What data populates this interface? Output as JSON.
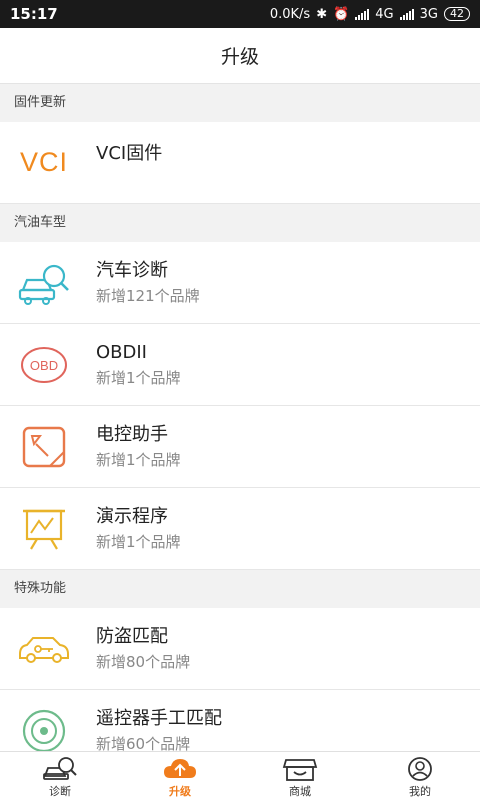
{
  "status": {
    "time": "15:17",
    "speed": "0.0K/s",
    "net1": "4G",
    "net2": "3G",
    "battery": "42"
  },
  "header": {
    "title": "升级"
  },
  "sections": [
    {
      "label": "固件更新"
    },
    {
      "label": "汽油车型"
    },
    {
      "label": "特殊功能"
    }
  ],
  "items": [
    {
      "title": "VCI固件",
      "icon": "vci-text-icon"
    },
    {
      "title": "汽车诊断",
      "sub": "新增121个品牌",
      "icon": "car-search-icon"
    },
    {
      "title": "OBDII",
      "sub": "新增1个品牌",
      "icon": "obd-icon"
    },
    {
      "title": "电控助手",
      "sub": "新增1个品牌",
      "icon": "ecu-tablet-icon"
    },
    {
      "title": "演示程序",
      "sub": "新增1个品牌",
      "icon": "presentation-board-icon"
    },
    {
      "title": "防盗匹配",
      "sub": "新增80个品牌",
      "icon": "car-key-icon"
    },
    {
      "title": "遥控器手工匹配",
      "sub": "新增60个品牌",
      "icon": "remote-control-icon"
    }
  ],
  "vci_icon_text": "VCI",
  "obd_icon_text": "OBD",
  "tabs": [
    {
      "label": "诊断",
      "icon": "diagnose-icon",
      "active": false
    },
    {
      "label": "升级",
      "icon": "upgrade-cloud-icon",
      "active": true
    },
    {
      "label": "商城",
      "icon": "store-icon",
      "active": false
    },
    {
      "label": "我的",
      "icon": "profile-icon",
      "active": false
    }
  ],
  "colors": {
    "accent": "#f07c1c",
    "teal": "#3ab7c9",
    "red": "#e0655c",
    "yellow": "#e9b32a",
    "green": "#6dbb8b"
  }
}
